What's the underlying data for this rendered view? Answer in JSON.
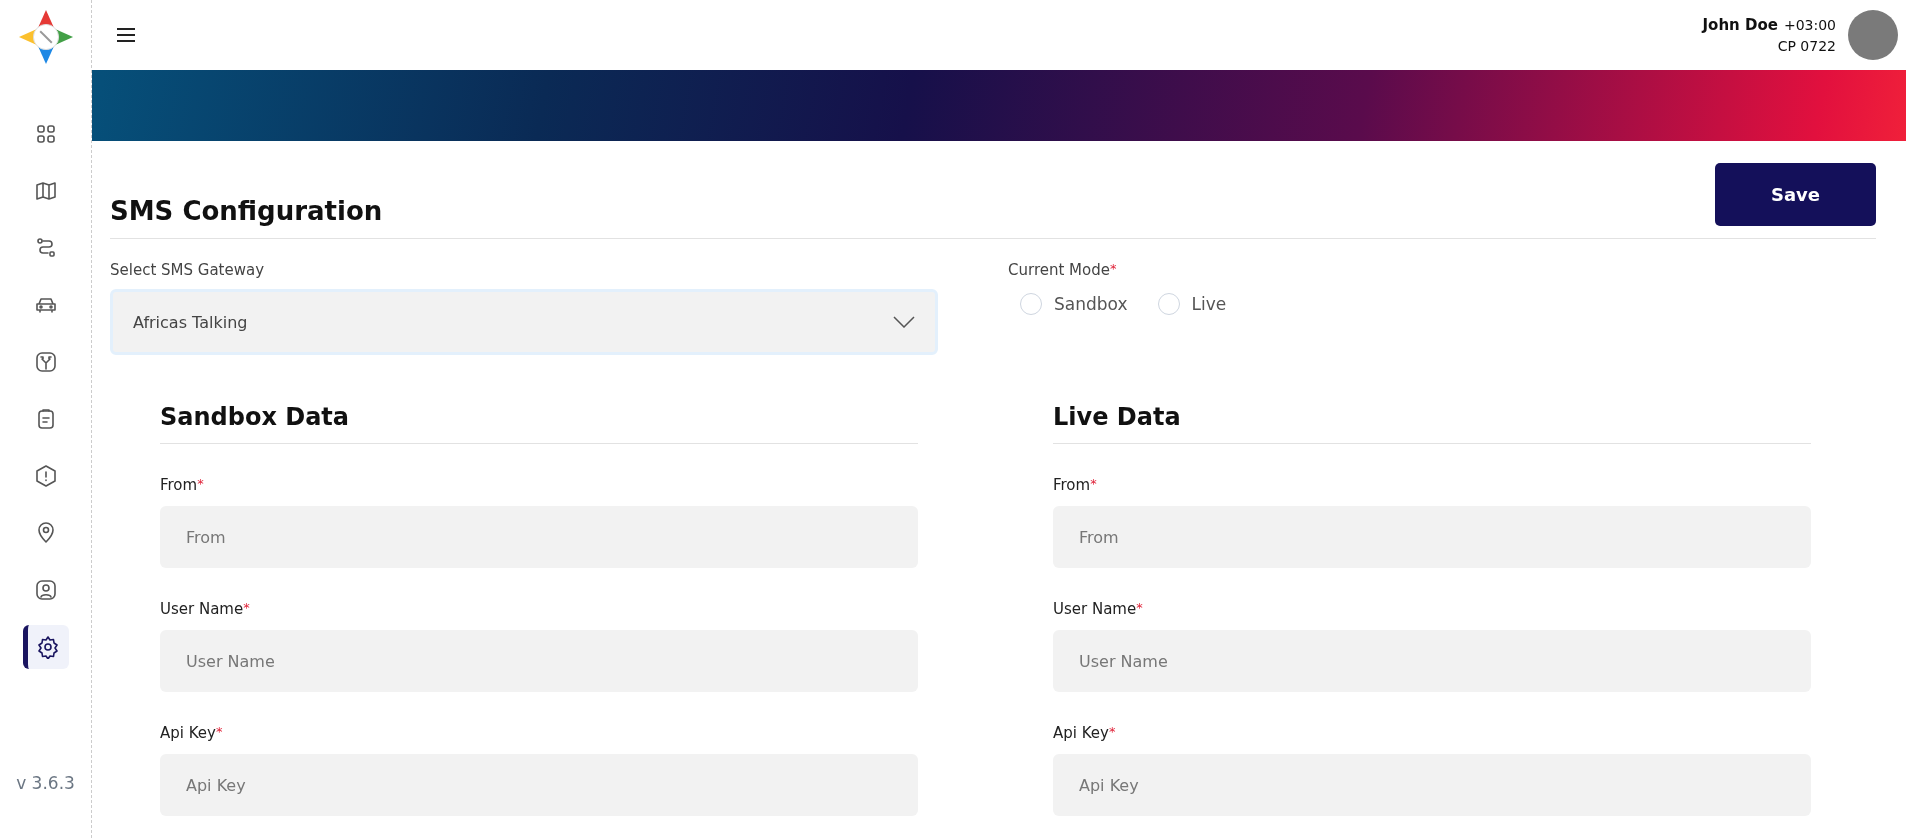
{
  "sidebar": {
    "items": [
      {
        "selected": false
      },
      {
        "selected": false
      },
      {
        "selected": false
      },
      {
        "selected": false
      },
      {
        "selected": false
      },
      {
        "selected": false
      },
      {
        "selected": false
      },
      {
        "selected": false
      },
      {
        "selected": false
      },
      {
        "selected": true
      }
    ],
    "version": "v 3.6.3"
  },
  "header": {
    "user_name": "John Doe",
    "timezone": "+03:00",
    "code": "CP 0722"
  },
  "page": {
    "title": "SMS Configuration",
    "save_button": "Save",
    "gateway": {
      "label": "Select SMS Gateway",
      "value": "Africas Talking"
    },
    "mode": {
      "label": "Current Mode",
      "required_mark": "*",
      "options": [
        {
          "label": "Sandbox",
          "selected": false
        },
        {
          "label": "Live",
          "selected": false
        }
      ]
    },
    "sections": [
      {
        "title": "Sandbox Data",
        "fields": [
          {
            "label": "From",
            "required_mark": "*",
            "placeholder": "From"
          },
          {
            "label": "User Name",
            "required_mark": "*",
            "placeholder": "User Name"
          },
          {
            "label": "Api Key",
            "required_mark": "*",
            "placeholder": "Api Key"
          }
        ]
      },
      {
        "title": "Live Data",
        "fields": [
          {
            "label": "From",
            "required_mark": "*",
            "placeholder": "From"
          },
          {
            "label": "User Name",
            "required_mark": "*",
            "placeholder": "User Name"
          },
          {
            "label": "Api Key",
            "required_mark": "*",
            "placeholder": "Api Key"
          }
        ]
      }
    ]
  }
}
